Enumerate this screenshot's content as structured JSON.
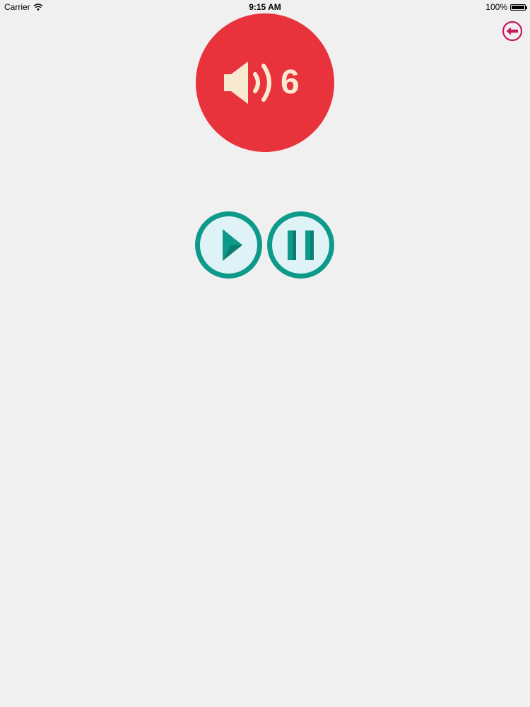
{
  "status_bar": {
    "carrier": "Carrier",
    "time": "9:15 AM",
    "battery": "100%"
  },
  "volume": {
    "level": "6",
    "icon": "speaker-icon"
  },
  "controls": {
    "play_icon": "play-icon",
    "pause_icon": "pause-icon",
    "back_icon": "back-arrow-icon"
  },
  "colors": {
    "background": "#f1f0f1",
    "volume_button": "#e8323c",
    "volume_glyph": "#f8ead0",
    "control_ring": "#0e9a8a",
    "control_fill": "#dff3f6",
    "back_accent": "#c8185e"
  }
}
